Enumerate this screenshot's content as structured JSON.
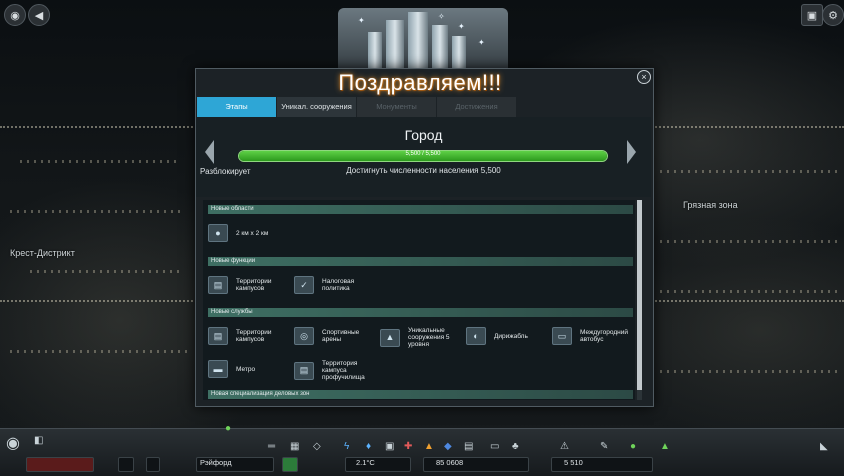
{
  "map": {
    "labels": [
      "Крест-Дистрикт",
      "Грязная зона"
    ]
  },
  "dialog": {
    "banner": "Поздравляем!!!",
    "close": "×",
    "tabs": [
      {
        "label": "Этапы",
        "state": "active"
      },
      {
        "label": "Уникал. сооружения",
        "state": "normal"
      },
      {
        "label": "Монументы",
        "state": "disabled"
      },
      {
        "label": "Достижения",
        "state": "disabled"
      }
    ],
    "milestone": {
      "title": "Город",
      "progress_text": "5,500 / 5,500",
      "progress_fraction": 1.0,
      "unlocks_label": "Разблокирует",
      "requirement": "Достигнуть численности населения 5,500"
    },
    "sections": [
      {
        "title": "Новые области",
        "items": [
          "2 км x 2 км"
        ]
      },
      {
        "title": "Новые функции",
        "items": [
          "Территории кампусов",
          "Налоговая политика"
        ]
      },
      {
        "title": "Новые службы",
        "items": [
          "Территории кампусов",
          "Спортивные арены",
          "Уникальные сооружения 5 уровня",
          "Дирижабль",
          "Междугородний автобус",
          "Метро",
          "Территория кампуса профучилища"
        ]
      },
      {
        "title": "Новая специализация деловых зон",
        "items": []
      }
    ]
  },
  "toolbar": {
    "district": "Рэйфорд",
    "temperature": "2.1°C",
    "money": "85 0608",
    "population": "5 510"
  },
  "colors": {
    "tab_active": "#2ea6d6",
    "progress": "#3dbb2a",
    "section_bar": "#3e6f63"
  }
}
